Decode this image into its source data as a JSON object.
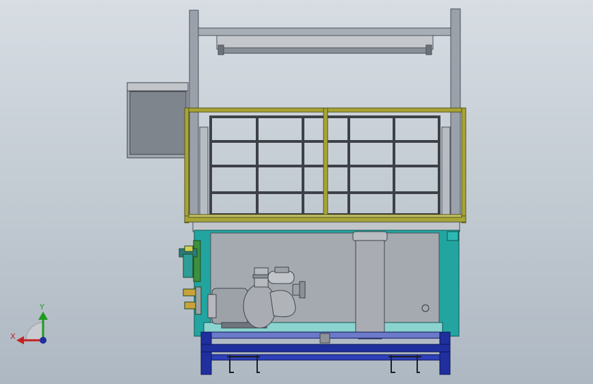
{
  "view": {
    "axes": {
      "x_label": "X",
      "y_label": "Y",
      "x_color": "#c42020",
      "y_color": "#1e9a1e"
    }
  },
  "palette": {
    "frame_grey": "#8f96a0",
    "rail_yellow": "#a7a436",
    "tank_teal": "#22a5a0",
    "tank_inner": "#a5aab1",
    "base_blue": "#1f2f9e",
    "pump_grey": "#a9adb3",
    "valve_green": "#3e8f3e"
  },
  "parts": [
    "upper-frame",
    "light-bar",
    "side-box",
    "guard-rail",
    "inner-grid",
    "tank",
    "pump",
    "filter-column",
    "inlet-valve",
    "base-stand",
    "casters"
  ]
}
